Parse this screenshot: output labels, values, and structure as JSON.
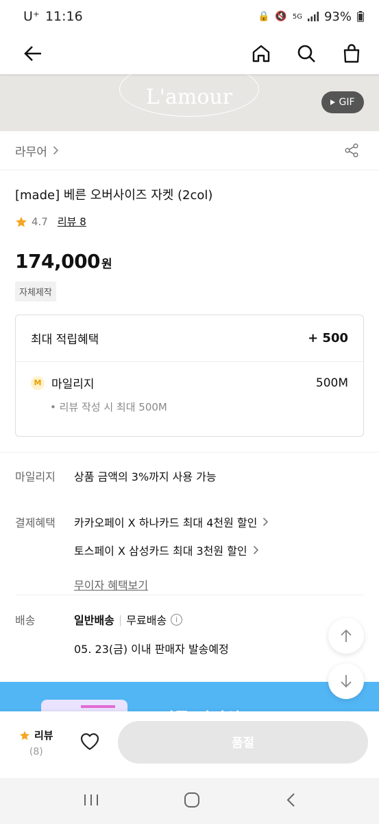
{
  "status_bar": {
    "carrier": "U⁺",
    "time": "11:16",
    "battery": "93%"
  },
  "nav": {
    "back_icon": "arrow-left-icon",
    "home_icon": "home-icon",
    "search_icon": "search-icon",
    "cart_icon": "shopping-bag-icon"
  },
  "banner": {
    "logo_text": "L'amour",
    "gif_label": "GIF"
  },
  "brand": {
    "name": "라무어",
    "share_icon": "share-icon"
  },
  "product": {
    "name": "[made] 베른 오버사이즈 자켓 (2col)",
    "rating": "4.7",
    "review_label": "리뷰 8",
    "price": "174,000",
    "currency": "원",
    "tag": "자체제작"
  },
  "points": {
    "header_label": "최대 적립혜택",
    "header_value": "+ 500",
    "mileage_badge": "M",
    "mileage_label": "마일리지",
    "mileage_value": "500M",
    "note": "• 리뷰 작성 시 최대 500M"
  },
  "info": {
    "mileage_label": "마일리지",
    "mileage_value": "상품 금액의 3%까지 사용 가능",
    "payment_label": "결제혜택",
    "payment_items": [
      "카카오페이 X 하나카드 최대 4천원 할인",
      "토스페이 X 삼성카드 최대 3천원 할인"
    ],
    "installment_link": "무이자 혜택보기",
    "delivery_label": "배송",
    "delivery_type": "일반배송",
    "delivery_fee": "무료배송",
    "delivery_date": "05. 23(금) 이내 판매자 발송예정"
  },
  "promo": {
    "text": "스피롬 직진위크 OPEN"
  },
  "bottom_bar": {
    "review_label": "리뷰",
    "review_count": "(8)",
    "buy_label": "품절"
  },
  "colors": {
    "star": "#f5a623",
    "promo_bg": "#52b6f5",
    "buy_disabled": "#e6e6e6"
  }
}
